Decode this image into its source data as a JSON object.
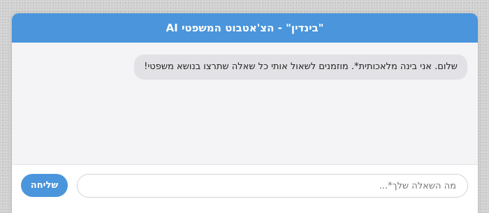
{
  "header": {
    "title": "\"בינדין\" - הצ'אטבוט המשפטי AI"
  },
  "messages": [
    {
      "sender": "bot",
      "text": "שלום. אני בינה מלאכותית*. מוזמנים לשאול אותי כל שאלה שתרצו בנושא משפטי!"
    }
  ],
  "input": {
    "placeholder": "מה השאלה שלך*...",
    "value": ""
  },
  "send_button": {
    "label": "שליחה"
  },
  "colors": {
    "accent": "#4a95dc",
    "bubble": "#e2e2e6",
    "background": "#f4f4f6"
  }
}
